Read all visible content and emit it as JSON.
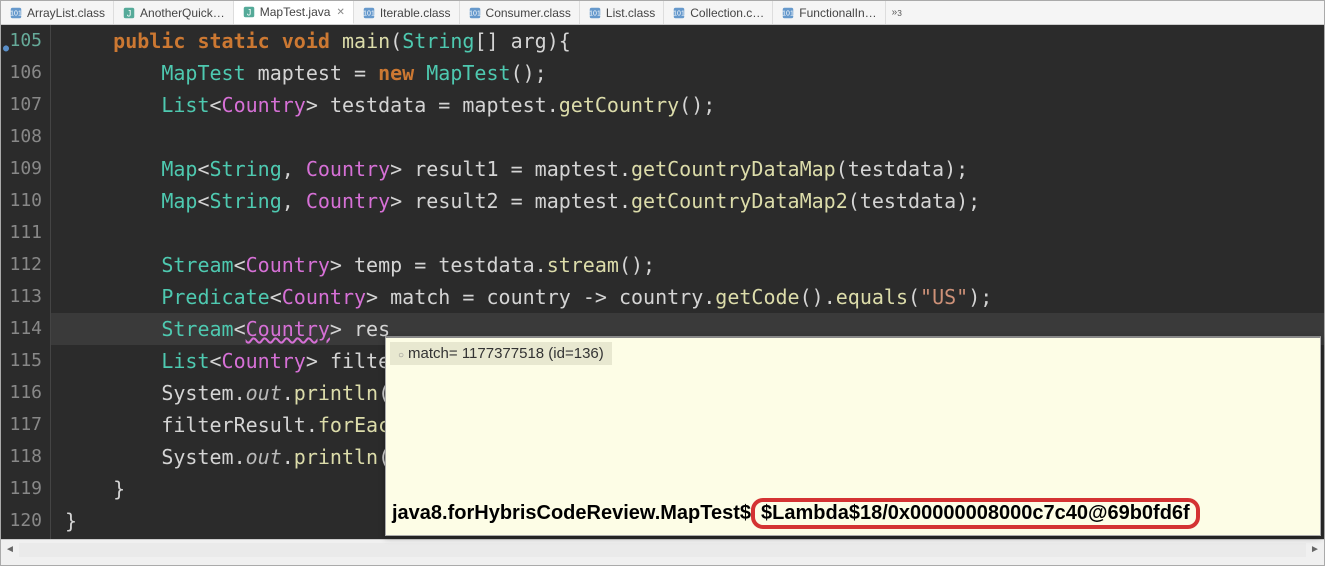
{
  "tabs": [
    {
      "label": "ArrayList.class",
      "icon": "class"
    },
    {
      "label": "AnotherQuick…",
      "icon": "java"
    },
    {
      "label": "MapTest.java",
      "icon": "java",
      "active": true
    },
    {
      "label": "Iterable.class",
      "icon": "class"
    },
    {
      "label": "Consumer.class",
      "icon": "class"
    },
    {
      "label": "List.class",
      "icon": "class"
    },
    {
      "label": "Collection.c…",
      "icon": "class"
    },
    {
      "label": "FunctionalIn…",
      "icon": "class"
    }
  ],
  "overflow_badge": "3",
  "gutter": {
    "start": 105,
    "end": 120,
    "breakpoint_lines": [
      105
    ],
    "highlight_line": 114
  },
  "code": {
    "lines": [
      {
        "n": 105,
        "tokens": [
          {
            "t": "    ",
            "c": ""
          },
          {
            "t": "public",
            "c": "kw"
          },
          {
            "t": " ",
            "c": ""
          },
          {
            "t": "static",
            "c": "kw"
          },
          {
            "t": " ",
            "c": ""
          },
          {
            "t": "void",
            "c": "kw"
          },
          {
            "t": " ",
            "c": ""
          },
          {
            "t": "main",
            "c": "method"
          },
          {
            "t": "(",
            "c": "punc"
          },
          {
            "t": "String",
            "c": "type"
          },
          {
            "t": "[] ",
            "c": "punc"
          },
          {
            "t": "arg",
            "c": "ident"
          },
          {
            "t": "){",
            "c": "punc"
          }
        ]
      },
      {
        "n": 106,
        "tokens": [
          {
            "t": "        ",
            "c": ""
          },
          {
            "t": "MapTest",
            "c": "type"
          },
          {
            "t": " ",
            "c": ""
          },
          {
            "t": "maptest",
            "c": "ident"
          },
          {
            "t": " = ",
            "c": "op"
          },
          {
            "t": "new",
            "c": "kw"
          },
          {
            "t": " ",
            "c": ""
          },
          {
            "t": "MapTest",
            "c": "type"
          },
          {
            "t": "();",
            "c": "punc"
          }
        ]
      },
      {
        "n": 107,
        "tokens": [
          {
            "t": "        ",
            "c": ""
          },
          {
            "t": "List",
            "c": "type"
          },
          {
            "t": "<",
            "c": "punc"
          },
          {
            "t": "Country",
            "c": "type2"
          },
          {
            "t": "> ",
            "c": "punc"
          },
          {
            "t": "testdata",
            "c": "ident"
          },
          {
            "t": " = ",
            "c": "op"
          },
          {
            "t": "maptest",
            "c": "ident"
          },
          {
            "t": ".",
            "c": "punc"
          },
          {
            "t": "getCountry",
            "c": "method"
          },
          {
            "t": "();",
            "c": "punc"
          }
        ]
      },
      {
        "n": 108,
        "tokens": []
      },
      {
        "n": 109,
        "tokens": [
          {
            "t": "        ",
            "c": ""
          },
          {
            "t": "Map",
            "c": "type"
          },
          {
            "t": "<",
            "c": "punc"
          },
          {
            "t": "String",
            "c": "type"
          },
          {
            "t": ", ",
            "c": "punc"
          },
          {
            "t": "Country",
            "c": "type2"
          },
          {
            "t": "> ",
            "c": "punc"
          },
          {
            "t": "result1",
            "c": "ident"
          },
          {
            "t": " = ",
            "c": "op"
          },
          {
            "t": "maptest",
            "c": "ident"
          },
          {
            "t": ".",
            "c": "punc"
          },
          {
            "t": "getCountryDataMap",
            "c": "method"
          },
          {
            "t": "(",
            "c": "punc"
          },
          {
            "t": "testdata",
            "c": "ident"
          },
          {
            "t": ");",
            "c": "punc"
          }
        ]
      },
      {
        "n": 110,
        "tokens": [
          {
            "t": "        ",
            "c": ""
          },
          {
            "t": "Map",
            "c": "type"
          },
          {
            "t": "<",
            "c": "punc"
          },
          {
            "t": "String",
            "c": "type"
          },
          {
            "t": ", ",
            "c": "punc"
          },
          {
            "t": "Country",
            "c": "type2"
          },
          {
            "t": "> ",
            "c": "punc"
          },
          {
            "t": "result2",
            "c": "ident"
          },
          {
            "t": " = ",
            "c": "op"
          },
          {
            "t": "maptest",
            "c": "ident"
          },
          {
            "t": ".",
            "c": "punc"
          },
          {
            "t": "getCountryDataMap2",
            "c": "method"
          },
          {
            "t": "(",
            "c": "punc"
          },
          {
            "t": "testdata",
            "c": "ident"
          },
          {
            "t": ");",
            "c": "punc"
          }
        ]
      },
      {
        "n": 111,
        "tokens": []
      },
      {
        "n": 112,
        "tokens": [
          {
            "t": "        ",
            "c": ""
          },
          {
            "t": "Stream",
            "c": "type"
          },
          {
            "t": "<",
            "c": "punc"
          },
          {
            "t": "Country",
            "c": "type2"
          },
          {
            "t": "> ",
            "c": "punc"
          },
          {
            "t": "temp",
            "c": "ident"
          },
          {
            "t": " = ",
            "c": "op"
          },
          {
            "t": "testdata",
            "c": "ident"
          },
          {
            "t": ".",
            "c": "punc"
          },
          {
            "t": "stream",
            "c": "method"
          },
          {
            "t": "();",
            "c": "punc"
          }
        ]
      },
      {
        "n": 113,
        "tokens": [
          {
            "t": "        ",
            "c": ""
          },
          {
            "t": "Predicate",
            "c": "type"
          },
          {
            "t": "<",
            "c": "punc"
          },
          {
            "t": "Country",
            "c": "type2"
          },
          {
            "t": "> ",
            "c": "punc"
          },
          {
            "t": "match",
            "c": "ident"
          },
          {
            "t": " = ",
            "c": "op"
          },
          {
            "t": "country",
            "c": "ident"
          },
          {
            "t": " -> ",
            "c": "op"
          },
          {
            "t": "country",
            "c": "ident"
          },
          {
            "t": ".",
            "c": "punc"
          },
          {
            "t": "getCode",
            "c": "method"
          },
          {
            "t": "()",
            "c": "punc"
          },
          {
            "t": ".",
            "c": "punc"
          },
          {
            "t": "equals",
            "c": "method"
          },
          {
            "t": "(",
            "c": "punc"
          },
          {
            "t": "\"US\"",
            "c": "str"
          },
          {
            "t": ");",
            "c": "punc"
          }
        ]
      },
      {
        "n": 114,
        "hl": true,
        "tokens": [
          {
            "t": "        ",
            "c": ""
          },
          {
            "t": "Stream",
            "c": "type"
          },
          {
            "t": "<",
            "c": "punc"
          },
          {
            "t": "Country",
            "c": "type2 underline-wave"
          },
          {
            "t": "> ",
            "c": "punc"
          },
          {
            "t": "res",
            "c": "ident"
          }
        ]
      },
      {
        "n": 115,
        "tokens": [
          {
            "t": "        ",
            "c": ""
          },
          {
            "t": "List",
            "c": "type"
          },
          {
            "t": "<",
            "c": "punc"
          },
          {
            "t": "Country",
            "c": "type2"
          },
          {
            "t": "> ",
            "c": "punc"
          },
          {
            "t": "filte",
            "c": "ident"
          }
        ]
      },
      {
        "n": 116,
        "tokens": [
          {
            "t": "        ",
            "c": ""
          },
          {
            "t": "System",
            "c": "ident"
          },
          {
            "t": ".",
            "c": "punc"
          },
          {
            "t": "out",
            "c": "field"
          },
          {
            "t": ".",
            "c": "punc"
          },
          {
            "t": "println",
            "c": "method"
          },
          {
            "t": "(",
            "c": "punc"
          }
        ]
      },
      {
        "n": 117,
        "tokens": [
          {
            "t": "        ",
            "c": ""
          },
          {
            "t": "filterResult",
            "c": "ident"
          },
          {
            "t": ".",
            "c": "punc"
          },
          {
            "t": "forEac",
            "c": "method"
          }
        ]
      },
      {
        "n": 118,
        "tokens": [
          {
            "t": "        ",
            "c": ""
          },
          {
            "t": "System",
            "c": "ident"
          },
          {
            "t": ".",
            "c": "punc"
          },
          {
            "t": "out",
            "c": "field"
          },
          {
            "t": ".",
            "c": "punc"
          },
          {
            "t": "println",
            "c": "method"
          },
          {
            "t": "(",
            "c": "punc"
          }
        ]
      },
      {
        "n": 119,
        "tokens": [
          {
            "t": "    }",
            "c": "punc"
          }
        ]
      },
      {
        "n": 120,
        "tokens": [
          {
            "t": "}",
            "c": "punc"
          }
        ]
      }
    ]
  },
  "tooltip": {
    "header": "match= 1177377518  (id=136)",
    "body_prefix": "java8.forHybrisCodeReview.MapTest$",
    "body_lambda": "$Lambda$18/0x00000008000c7c40@69b0fd6f"
  }
}
